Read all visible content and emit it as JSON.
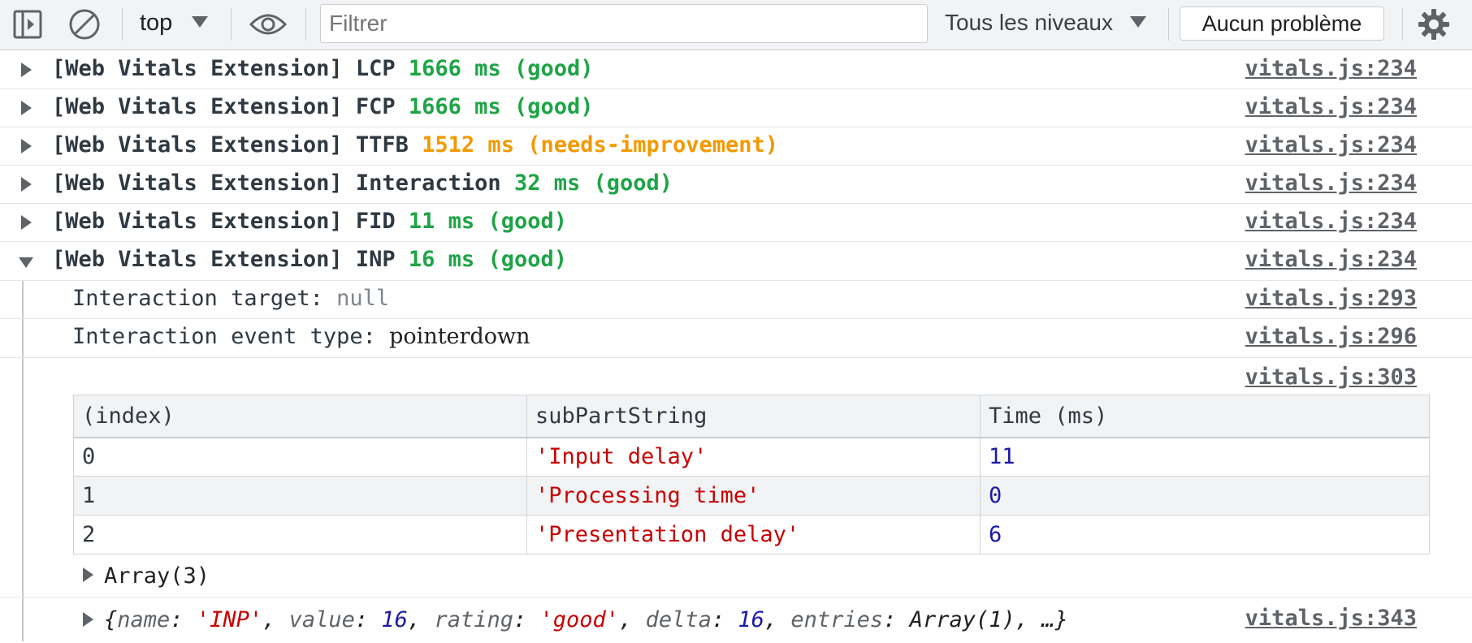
{
  "toolbar": {
    "context": "top",
    "filter_placeholder": "Filtrer",
    "levels": "Tous les niveaux",
    "issues": "Aucun problème"
  },
  "messages": [
    {
      "prefix": "[Web Vitals Extension] LCP ",
      "value": "1666 ms (good)",
      "rating": "good",
      "source": "vitals.js:234"
    },
    {
      "prefix": "[Web Vitals Extension] FCP ",
      "value": "1666 ms (good)",
      "rating": "good",
      "source": "vitals.js:234"
    },
    {
      "prefix": "[Web Vitals Extension] TTFB ",
      "value": "1512 ms (needs-improvement)",
      "rating": "needs-improvement",
      "source": "vitals.js:234"
    },
    {
      "prefix": "[Web Vitals Extension] Interaction ",
      "value": "32 ms (good)",
      "rating": "good",
      "source": "vitals.js:234"
    },
    {
      "prefix": "[Web Vitals Extension] FID ",
      "value": "11 ms (good)",
      "rating": "good",
      "source": "vitals.js:234"
    },
    {
      "prefix": "[Web Vitals Extension] INP ",
      "value": "16 ms (good)",
      "rating": "good",
      "source": "vitals.js:234"
    }
  ],
  "group": {
    "target_label": "Interaction target: ",
    "target_value": "null",
    "target_source": "vitals.js:293",
    "event_label": "Interaction event type: ",
    "event_value": "pointerdown",
    "event_source": "vitals.js:296",
    "table_source": "vitals.js:303",
    "table": {
      "headers": [
        "(index)",
        "subPartString",
        "Time (ms)"
      ],
      "rows": [
        [
          "0",
          "'Input delay'",
          "11"
        ],
        [
          "1",
          "'Processing time'",
          "0"
        ],
        [
          "2",
          "'Presentation delay'",
          "6"
        ]
      ]
    },
    "array_label": "Array(3)",
    "object": {
      "open": "{",
      "name_key": "name",
      "name_value": "'INP'",
      "value_key": "value",
      "value_value": "16",
      "rating_key": "rating",
      "rating_value": "'good'",
      "delta_key": "delta",
      "delta_value": "16",
      "entries_key": "entries",
      "entries_value": "Array(1)",
      "ellipsis": "…}",
      "colon": ": ",
      "comma": ", "
    },
    "object_source": "vitals.js:343"
  },
  "colors": {
    "good": "#1ea446",
    "needs_improvement": "#f29900",
    "string": "#c80000",
    "number": "#1a1aa6"
  }
}
